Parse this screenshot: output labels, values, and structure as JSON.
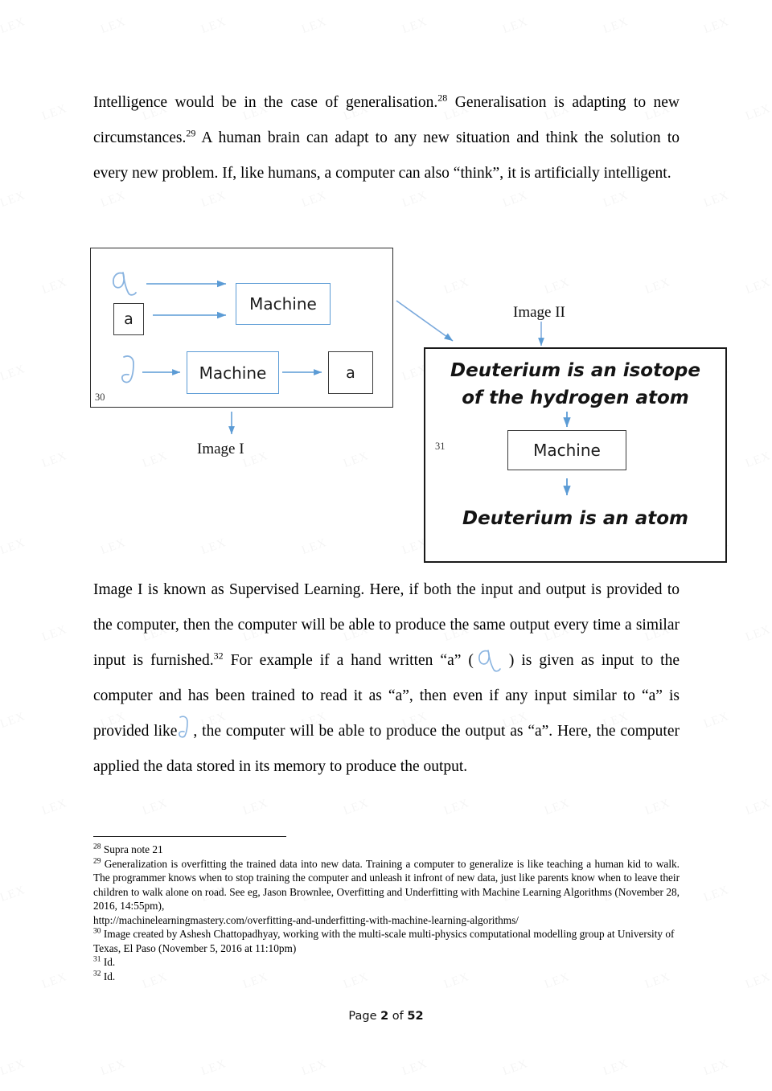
{
  "document": {
    "page_footer_prefix": "Page ",
    "page_number": "2",
    "page_footer_middle": " of ",
    "page_total": "52"
  },
  "body": {
    "paragraph_1_part1": "Intelligence would be in the case of generalisation.",
    "paragraph_1_sup1": "28",
    "paragraph_1_part2": " Generalisation is adapting to new circumstances.",
    "paragraph_1_sup2": "29",
    "paragraph_1_part3": " A human brain can adapt to any new situation and think the solution to every new problem. If, like humans, a computer can also “think”, it is artificially intelligent.",
    "paragraph_2_part1": "Image I is known as Supervised Learning. Here, if both the input and output is provided to the computer, then the computer will be able to produce the same output every time a similar input is furnished.",
    "paragraph_2_sup1": "32",
    "paragraph_2_part2": " For example if a hand written “a” (",
    "paragraph_2_part3": ") is given as input to the computer and has been trained to read it as “a”, then even if any input similar to “a” is provided like",
    "paragraph_2_part4": ", the computer will be able to produce the output as “a”. Here, the computer applied the data stored in its memory to produce the output."
  },
  "figures": {
    "image1": {
      "caption": "Image I",
      "footnote_marker": "30",
      "machine_top_label": "Machine",
      "machine_bottom_label": "Machine",
      "input_letter_box_label": "a",
      "output_letter_box_label": "a"
    },
    "image2": {
      "caption": "Image II",
      "footnote_marker": "31",
      "input_line1": "Deuterium is an isotope",
      "input_line2": "of the hydrogen atom",
      "machine_label": "Machine",
      "output_text": "Deuterium is an atom"
    }
  },
  "footnotes": [
    {
      "marker": "28",
      "text": "Supra note 21"
    },
    {
      "marker": "29",
      "text": "Generalization is overfitting the trained data into new data. Training a computer to generalize is like teaching a human kid to walk. The programmer knows when to stop training the computer and unleash it infront of new data, just like parents know when to leave their children to walk alone on road. See eg, Jason Brownlee, Overfitting and Underfitting with Machine Learning Algorithms (November 28, 2016, 14:55pm),"
    },
    {
      "marker": "",
      "text": "http://machinelearningmastery.com/overfitting-and-underfitting-with-machine-learning-algorithms/"
    },
    {
      "marker": "30",
      "text": "Image created by Ashesh Chattopadhyay, working with the multi-scale multi-physics computational modelling group at University of Texas, El Paso (November 5, 2016 at 11:10pm)"
    },
    {
      "marker": "31",
      "text": "Id."
    },
    {
      "marker": "32",
      "text": "Id."
    }
  ],
  "colors": {
    "accent_blue": "#5b9bd5",
    "box_black": "#2b2b2b",
    "text_black": "#000000",
    "watermark": "rgba(0,0,0,0.045)"
  },
  "watermark_text": "LEX"
}
